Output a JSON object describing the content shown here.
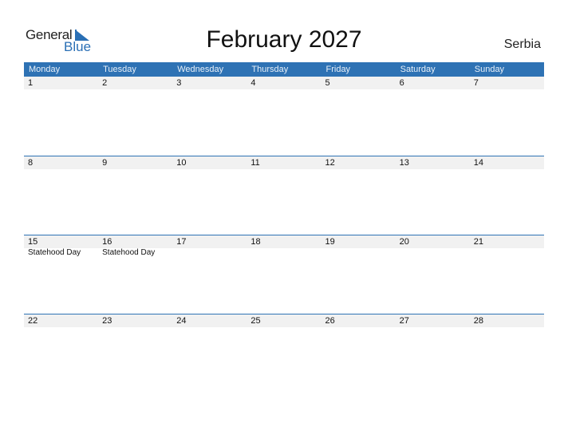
{
  "logo": {
    "general": "General",
    "blue": "Blue"
  },
  "title": "February 2027",
  "country": "Serbia",
  "colors": {
    "accent": "#2e72b4",
    "date_row_bg": "#f1f1f1"
  },
  "weekdays": [
    "Monday",
    "Tuesday",
    "Wednesday",
    "Thursday",
    "Friday",
    "Saturday",
    "Sunday"
  ],
  "weeks": [
    {
      "dates": [
        "1",
        "2",
        "3",
        "4",
        "5",
        "6",
        "7"
      ],
      "events": [
        "",
        "",
        "",
        "",
        "",
        "",
        ""
      ]
    },
    {
      "dates": [
        "8",
        "9",
        "10",
        "11",
        "12",
        "13",
        "14"
      ],
      "events": [
        "",
        "",
        "",
        "",
        "",
        "",
        ""
      ]
    },
    {
      "dates": [
        "15",
        "16",
        "17",
        "18",
        "19",
        "20",
        "21"
      ],
      "events": [
        "Statehood Day",
        "Statehood Day",
        "",
        "",
        "",
        "",
        ""
      ]
    },
    {
      "dates": [
        "22",
        "23",
        "24",
        "25",
        "26",
        "27",
        "28"
      ],
      "events": [
        "",
        "",
        "",
        "",
        "",
        "",
        ""
      ]
    }
  ]
}
